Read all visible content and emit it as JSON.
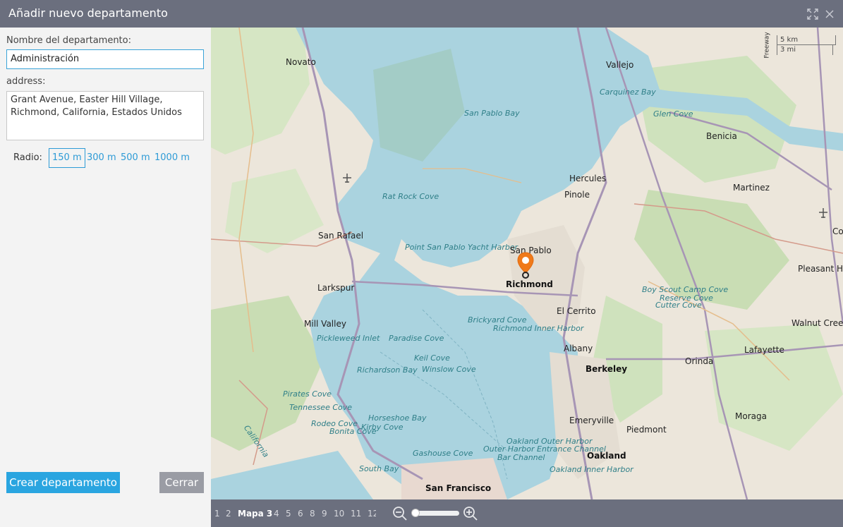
{
  "dialog": {
    "title": "Añadir nuevo departamento"
  },
  "form": {
    "name_label": "Nombre del departamento:",
    "name_value": "Administración",
    "address_label": "address:",
    "address_value": "Grant Avenue, Easter Hill Village, Richmond, California, Estados Unidos",
    "radius_label": "Radio:",
    "radius_options": [
      "150 m",
      "300 m",
      "500 m",
      "1000 m"
    ],
    "radius_selected": "150 m"
  },
  "buttons": {
    "create": "Crear departamento",
    "close": "Cerrar"
  },
  "map": {
    "scale_km": "5 km",
    "scale_mi": "3 mi",
    "marker_label": "Richmond",
    "labels": {
      "novato": "Novato",
      "vallejo": "Vallejo",
      "carquinez": "Carquinez Bay",
      "glen_cove": "Glen Cove",
      "benicia": "Benicia",
      "san_pablo_bay": "San Pablo Bay",
      "hercules": "Hercules",
      "pinole": "Pinole",
      "martinez": "Martinez",
      "rat_rock": "Rat Rock Cove",
      "san_rafael": "San Rafael",
      "point_sp": "Point San Pablo Yacht Harbor",
      "san_pablo": "San Pablo",
      "richmond": "Richmond",
      "pleasant_hill": "Pleasant Hill",
      "larkspur": "Larkspur",
      "boy_scout": "Boy Scout Camp Cove",
      "reserve": "Reserve Cove",
      "cutter": "Cutter Cove",
      "el_cerrito": "El Cerrito",
      "mill_valley": "Mill Valley",
      "brickyard": "Brickyard Cove",
      "richmond_inner": "Richmond Inner Harbor",
      "walnut": "Walnut Creek",
      "pickleweed": "Pickleweed Inlet",
      "paradise": "Paradise Cove",
      "albany": "Albany",
      "lafayette": "Lafayette",
      "keil": "Keil Cove",
      "winslow": "Winslow Cove",
      "berkeley": "Berkeley",
      "orinda": "Orinda",
      "richardson": "Richardson Bay",
      "pirates": "Pirates Cove",
      "tennessee": "Tennessee Cove",
      "rodeo": "Rodeo Cove",
      "bonita": "Bonita Cove",
      "horseshoe": "Horseshoe Bay",
      "kirby": "Kirby Cove",
      "emeryville": "Emeryville",
      "moraga": "Moraga",
      "piedmont": "Piedmont",
      "oakland_outer": "Oakland Outer Harbor",
      "outer_entrance": "Outer Harbor Entrance Channel",
      "gashouse": "Gashouse Cove",
      "bar_channel": "Bar Channel",
      "oakland": "Oakland",
      "oakland_inner": "Oakland Inner Harbor",
      "south_bay": "South Bay",
      "san_francisco": "San Francisco",
      "california": "California",
      "freeway": "Freeway",
      "con": "Co"
    }
  },
  "map_tabs": [
    "1",
    "2",
    "Mapa 3",
    "4",
    "5",
    "6",
    "8",
    "9",
    "10",
    "11",
    "12"
  ],
  "map_tab_active": "Mapa 3",
  "colors": {
    "titlebar": "#6b6f7e",
    "accent": "#2aa5e0",
    "water": "#aad3df",
    "marker": "#f07a1a"
  }
}
